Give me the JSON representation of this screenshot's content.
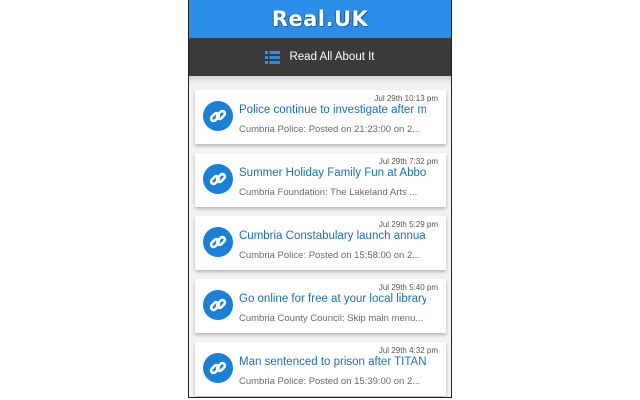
{
  "header": {
    "brand": "Real.UK",
    "brand_color": "#2a8de8"
  },
  "nav": {
    "label": "Read All About It",
    "icon": "list-icon",
    "bg_color": "#3a3a3a"
  },
  "feed": {
    "item_icon": "link-icon",
    "accent_color": "#1a7fd6",
    "items": [
      {
        "date": "Jul 29th 10:13 pm",
        "title": "Police continue to investigate after m...",
        "subtitle": "Cumbria Police: Posted on 21:23:00 on 2..."
      },
      {
        "date": "Jul 29th 7:32 pm",
        "title": "Summer Holiday Family Fun at Abbo...",
        "subtitle": "Cumbria Foundation: The Lakeland Arts ..."
      },
      {
        "date": "Jul 29th 5:29 pm",
        "title": "Cumbria Constabulary launch annua...",
        "subtitle": "Cumbria Police: Posted on 15:58:00 on 2..."
      },
      {
        "date": "Jul 29th 5:40 pm",
        "title": "Go online for free at your local library",
        "subtitle": "Cumbria County Council: Skip main menu..."
      },
      {
        "date": "Jul 29th 4:32 pm",
        "title": "Man sentenced to prison after TITAN",
        "subtitle": "Cumbria Police: Posted on 15:39:00 on 2..."
      }
    ]
  }
}
